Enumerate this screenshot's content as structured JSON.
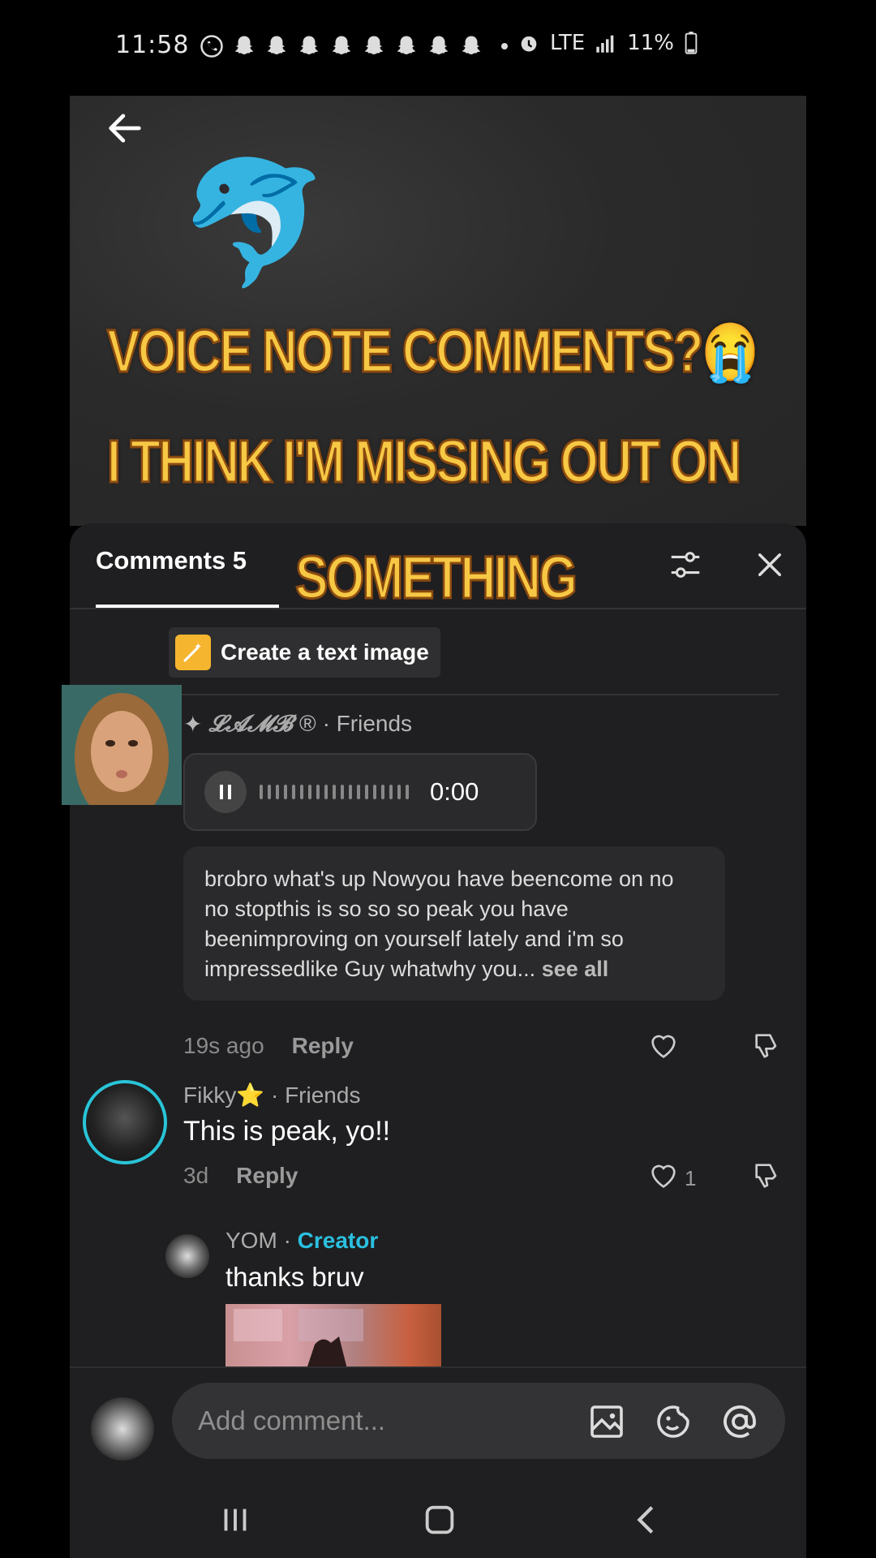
{
  "status_bar": {
    "time": "11:58",
    "network": "LTE",
    "battery": "11%"
  },
  "video": {
    "caption_line1": "VOICE NOTE COMMENTS?",
    "caption_emoji": "😭",
    "caption_line2": "I THINK I'M MISSING OUT ON",
    "caption_line3": "SOMETHING",
    "dolphin": "🐬"
  },
  "comments_header": {
    "tab_label": "Comments 5"
  },
  "text_image_button": {
    "label": "Create a text image"
  },
  "comments": [
    {
      "author": "𝓛𝓐𝓜𝓑",
      "author_suffix": "®",
      "relation": "· Friends",
      "voice_note_time": "0:00",
      "transcript": "brobro what's up Nowyou have beencome on no no stopthis is so so so peak you have beenimproving on yourself lately and i'm so impressedlike Guy whatwhy you...",
      "see_all": "see all",
      "age": "19s ago",
      "reply": "Reply"
    },
    {
      "author": "Fikky⭐",
      "relation": "· Friends",
      "text": "This is peak, yo!!",
      "age": "3d",
      "reply": "Reply",
      "likes": "1"
    },
    {
      "author": "YOM",
      "relation_prefix": "·",
      "badge": "Creator",
      "text": "thanks bruv"
    }
  ],
  "input_bar": {
    "placeholder": "Add comment..."
  },
  "colors": {
    "caption": "#f7c844",
    "caption_stroke": "#8a4a10",
    "creator": "#2bc0e0",
    "sheet_bg": "#1f1f21",
    "avatar_ring": "#29c4d8"
  }
}
